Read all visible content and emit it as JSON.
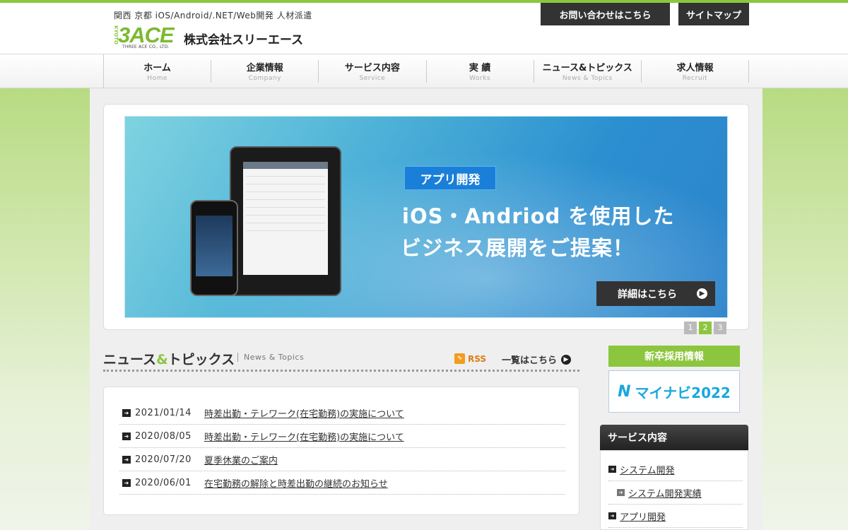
{
  "header": {
    "tagline": "関西 京都 iOS/Android/.NET/Web開発 人材派遣",
    "logo_kyoto": "KYOTO",
    "logo_main": "3ACE",
    "logo_sub": "THREE ACE CO., LTD.",
    "company_name": "株式会社スリーエース",
    "contact_button": "お問い合わせはこちら",
    "sitemap_button": "サイトマップ"
  },
  "nav": {
    "items": [
      {
        "jp": "ホーム",
        "en": "Home"
      },
      {
        "jp": "企業情報",
        "en": "Company"
      },
      {
        "jp": "サービス内容",
        "en": "Service"
      },
      {
        "jp": "実 績",
        "en": "Works"
      },
      {
        "jp": "ニュース&トピックス",
        "en": "News & Topics"
      },
      {
        "jp": "求人情報",
        "en": "Recruit"
      }
    ]
  },
  "banner": {
    "tag": "アプリ開発",
    "headline1": "iOS・Andriod を使用した",
    "headline2": "ビジネス展開をご提案！",
    "detail_button": "詳細はこちら",
    "pages": [
      "1",
      "2",
      "3"
    ],
    "active_page": "2"
  },
  "news": {
    "title_a": "ニュース",
    "title_amp": "&",
    "title_b": "トピックス",
    "subtitle": "News & Topics",
    "rss_label": "RSS",
    "more_label": "一覧はこちら",
    "items": [
      {
        "date": "2021/01/14",
        "title": "時差出勤・テレワーク(在宅勤務)の実施について"
      },
      {
        "date": "2020/08/05",
        "title": "時差出勤・テレワーク(在宅勤務)の実施について"
      },
      {
        "date": "2020/07/20",
        "title": "夏季休業のご案内"
      },
      {
        "date": "2020/06/01",
        "title": "在宅勤務の解除と時差出勤の継続のお知らせ"
      }
    ]
  },
  "sidebar": {
    "recruit_label": "新卒採用情報",
    "mynavi_mark": "N",
    "mynavi_text": "マイナビ",
    "mynavi_year": "2022",
    "services_title": "サービス内容",
    "services": [
      {
        "label": "システム開発",
        "sub": false
      },
      {
        "label": "システム開発実績",
        "sub": true
      },
      {
        "label": "アプリ開発",
        "sub": false
      }
    ]
  },
  "colors": {
    "accent_green": "#8cc63f",
    "dark": "#333333",
    "banner_blue": "#2b8fd0"
  }
}
